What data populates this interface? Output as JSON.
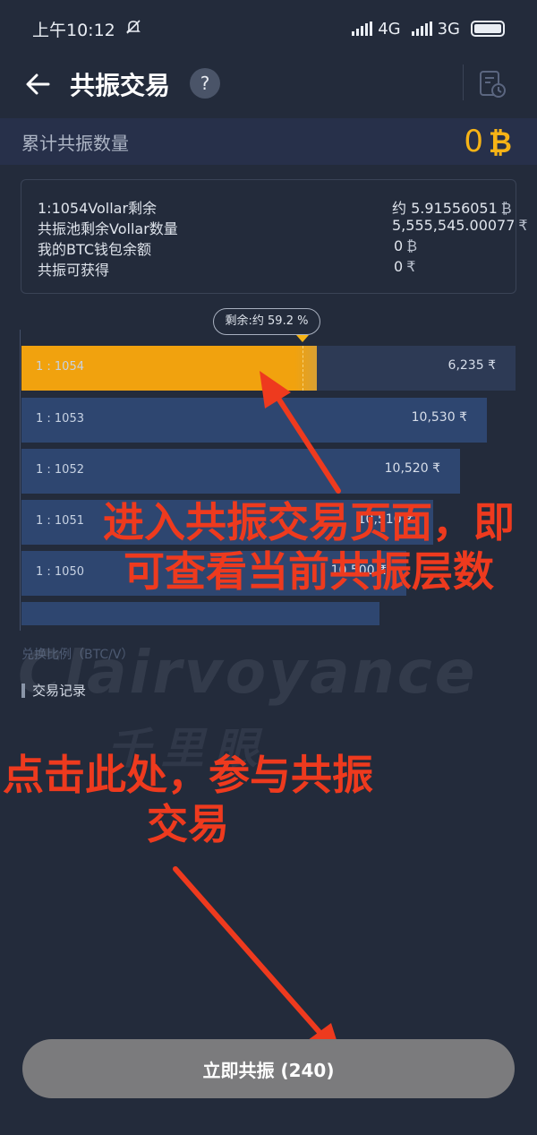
{
  "status_bar": {
    "time": "上午10:12",
    "network1": "4G",
    "network2": "3G"
  },
  "header": {
    "title": "共振交易",
    "help_label": "?"
  },
  "resonance": {
    "label": "累计共振数量",
    "value": "0",
    "symbol": "₿"
  },
  "info": {
    "rows": [
      {
        "label": "1:1054Vollar剩余",
        "value": "约 5.91556051",
        "unit": "₿"
      },
      {
        "label": "共振池剩余Vollar数量",
        "value": "5,555,545.00077",
        "unit": "₹"
      },
      {
        "label": "我的BTC钱包余额",
        "value": "0",
        "unit": "₿"
      },
      {
        "label": "共振可获得",
        "value": "0",
        "unit": "₹"
      }
    ]
  },
  "chart": {
    "remain_label": "剩余:约 59.2 %",
    "axis_caption": "兑换比例（BTC/V）",
    "bars": [
      {
        "label": "1 : 1054",
        "value": "6,235",
        "unit": "₹"
      },
      {
        "label": "1 : 1053",
        "value": "10,530",
        "unit": "₹"
      },
      {
        "label": "1 : 1052",
        "value": "10,520",
        "unit": "₹"
      },
      {
        "label": "1 : 1051",
        "value": "10,510",
        "unit": "₹"
      },
      {
        "label": "1 : 1050",
        "value": "10,500",
        "unit": "₹"
      }
    ],
    "first_bar_fill": 0.565
  },
  "records": {
    "label": "交易记录"
  },
  "watermark": {
    "line1": "Clairvoyance",
    "line2": "千里眼"
  },
  "annotations": {
    "text1": "进入共振交易页面，即可查看当前共振层数",
    "text2": "点击此处，参与共振交易"
  },
  "cta": {
    "label": "立即共振 (240)"
  },
  "colors": {
    "accent": "#f6b316",
    "annotation": "#ee3a1e",
    "bar": "#2e4670",
    "bar_active": "#f1a20e"
  }
}
